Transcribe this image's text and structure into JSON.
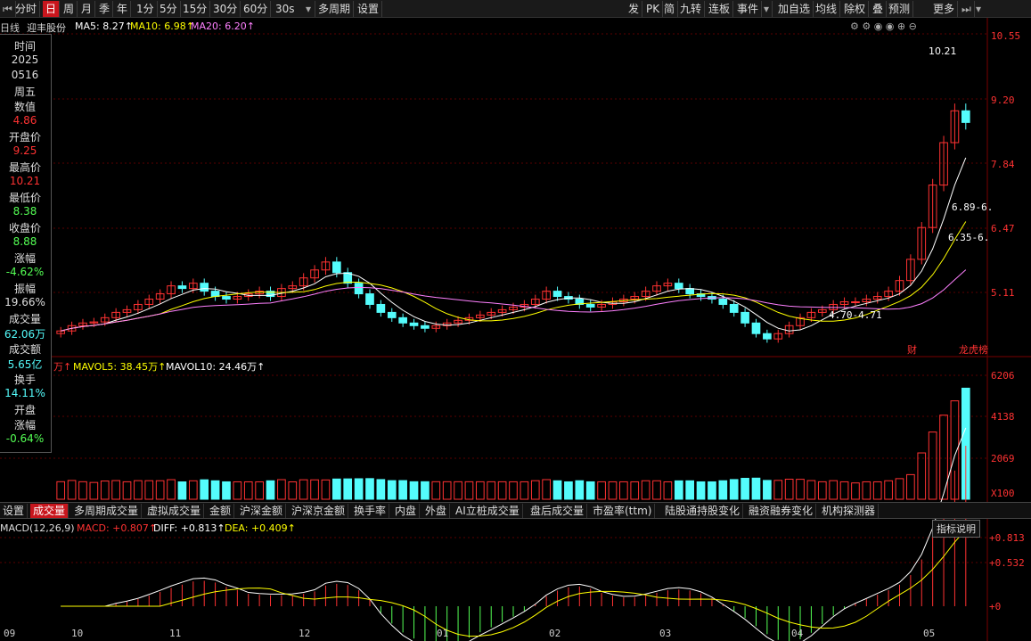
{
  "toolbar": {
    "items": [
      "分时",
      "日",
      "周",
      "月",
      "季",
      "年",
      "1分",
      "5分",
      "15分",
      "30分",
      "60分",
      "30s",
      "多周期",
      "设置"
    ],
    "active": "日",
    "right": [
      "发",
      "PK",
      "简",
      "九转",
      "连板",
      "事件",
      "加自选",
      "均线",
      "除权",
      "叠",
      "预测",
      "更多"
    ]
  },
  "header": {
    "period": "日线",
    "name": "迎丰股份",
    "ma5": "MA5: 8.27↑",
    "ma10": "MA10: 6.98↑",
    "ma20": "MA20: 6.20↑"
  },
  "info": [
    {
      "label": "时间",
      "value": "2025"
    },
    {
      "label": "",
      "value": "0516"
    },
    {
      "label": "周五",
      "value": ""
    },
    {
      "label": "数值",
      "value": "4.86"
    },
    {
      "label": "开盘价",
      "value": "9.25"
    },
    {
      "label": "最高价",
      "value": "10.21"
    },
    {
      "label": "最低价",
      "value": "8.38"
    },
    {
      "label": "收盘价",
      "value": "8.88"
    },
    {
      "label": "涨幅",
      "value": "-4.62%"
    },
    {
      "label": "振幅",
      "value": "19.66%"
    },
    {
      "label": "成交量",
      "value": "62.06万"
    },
    {
      "label": "成交额",
      "value": "5.65亿"
    },
    {
      "label": "换手",
      "value": "14.11%"
    },
    {
      "label": "开盘",
      "value": ""
    },
    {
      "label": "涨幅",
      "value": "-0.64%"
    }
  ],
  "price_axis": [
    "10.55",
    "9.20",
    "7.84",
    "6.47",
    "5.11"
  ],
  "annot": {
    "high": "10.21",
    "low": "4.70-4.71",
    "band1": "6.89-6.",
    "band2": "6.35-6.",
    "cai": "财",
    "bang": "龙虎榜"
  },
  "vol": {
    "unit": "万↑",
    "mavol5": "MAVOL5: 38.45万↑",
    "mavol10": "MAVOL10: 24.46万↑",
    "axis": [
      "6206",
      "4138",
      "2069",
      "X100"
    ]
  },
  "tabs": [
    "设置",
    "成交量",
    "多周期成交量",
    "虚拟成交量",
    "金额",
    "沪深金额",
    "沪深京金额",
    "换手率",
    "内盘",
    "外盘",
    "AI立桩成交量",
    "盘后成交量",
    "市盈率(ttm)",
    "陆股通持股变化",
    "融资融券变化",
    "机构探测器"
  ],
  "active_tab": "成交量",
  "macd": {
    "name": "MACD(12,26,9)",
    "macd": "MACD: +0.807↑",
    "diff": "DIFF: +0.813↑",
    "dea": "DEA: +0.409↑",
    "button": "指标说明",
    "axis": [
      "+0.813",
      "+0.532",
      "+0"
    ]
  },
  "months": [
    "09",
    "10",
    "11",
    "12",
    "01",
    "02",
    "03",
    "04",
    "05"
  ],
  "colors": {
    "up": "#ff3232",
    "down": "#54fcfc",
    "ma5": "#ffffff",
    "ma10": "#ffff00",
    "ma20": "#ff80ff"
  },
  "chart_data": {
    "type": "candlestick",
    "title": "迎丰股份 日线",
    "x": [
      "2024-09",
      "2024-10",
      "2024-11",
      "2024-12",
      "2025-01",
      "2025-02",
      "2025-03",
      "2025-04",
      "2025-05"
    ],
    "close": [
      4.95,
      5.05,
      5.1,
      5.12,
      5.2,
      5.3,
      5.35,
      5.45,
      5.55,
      5.65,
      5.8,
      5.75,
      5.85,
      5.7,
      5.6,
      5.55,
      5.6,
      5.65,
      5.7,
      5.6,
      5.75,
      5.8,
      5.95,
      6.1,
      6.25,
      6.05,
      5.85,
      5.65,
      5.45,
      5.3,
      5.2,
      5.1,
      5.05,
      5.0,
      5.05,
      5.1,
      5.15,
      5.2,
      5.25,
      5.3,
      5.35,
      5.4,
      5.45,
      5.55,
      5.7,
      5.6,
      5.55,
      5.45,
      5.4,
      5.45,
      5.5,
      5.55,
      5.6,
      5.7,
      5.8,
      5.85,
      5.75,
      5.65,
      5.6,
      5.55,
      5.45,
      5.3,
      5.1,
      4.9,
      4.8,
      4.9,
      5.05,
      5.2,
      5.3,
      5.35,
      5.45,
      5.5,
      5.5,
      5.55,
      5.6,
      5.7,
      5.9,
      6.3,
      6.9,
      7.7,
      8.5,
      9.1,
      8.88
    ],
    "ylim": [
      4.5,
      10.55
    ],
    "volume_max": 6206,
    "macd_axis": [
      0,
      0.532,
      0.813
    ]
  }
}
